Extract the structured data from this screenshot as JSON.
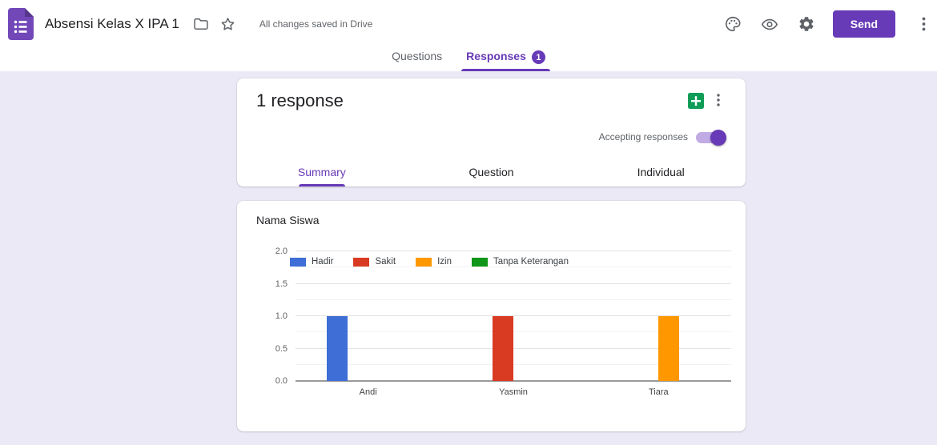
{
  "topbar": {
    "title": "Absensi Kelas X IPA 1",
    "saved_status": "All changes saved in Drive",
    "send_label": "Send"
  },
  "tabs": {
    "questions": "Questions",
    "responses": "Responses",
    "responses_badge": "1"
  },
  "response_card": {
    "count_label": "1 response",
    "accepting_label": "Accepting responses",
    "accepting_on": true,
    "subtabs": [
      {
        "label": "Summary",
        "active": true
      },
      {
        "label": "Question",
        "active": false
      },
      {
        "label": "Individual",
        "active": false
      }
    ]
  },
  "chart_card": {
    "title": "Nama Siswa"
  },
  "chart_data": {
    "type": "bar",
    "title": "Nama Siswa",
    "categories": [
      "Andi",
      "Yasmin",
      "Tiara"
    ],
    "series": [
      {
        "name": "Hadir",
        "color": "#3e6ed6",
        "values": [
          1,
          0,
          0
        ]
      },
      {
        "name": "Sakit",
        "color": "#d93b22",
        "values": [
          0,
          1,
          0
        ]
      },
      {
        "name": "Izin",
        "color": "#ff9800",
        "values": [
          0,
          0,
          1
        ]
      },
      {
        "name": "Tanpa Keterangan",
        "color": "#109618",
        "values": [
          0,
          0,
          0
        ]
      }
    ],
    "ylim": [
      0,
      2
    ],
    "yticks": [
      0,
      0.5,
      1,
      1.5,
      2
    ],
    "ytick_labels": [
      "0.0",
      "0.5",
      "1.0",
      "1.5",
      "2.0"
    ],
    "minor_tick_step": 0.25,
    "grid": true,
    "legend_position": "top-left-inside",
    "xlabel": "",
    "ylabel": ""
  },
  "colors": {
    "accent": "#673ab7",
    "background": "#ece9f6",
    "sheets_green": "#0f9d58"
  }
}
